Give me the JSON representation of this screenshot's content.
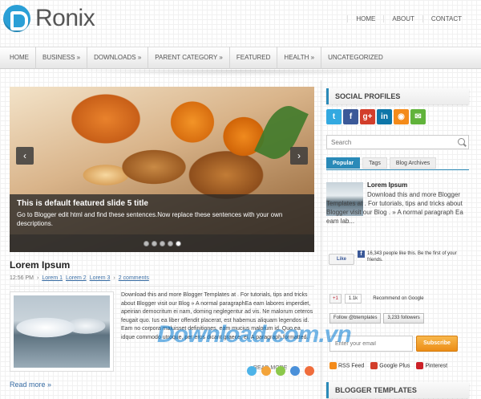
{
  "header": {
    "logo_text": "Ronix",
    "top_nav": [
      "HOME",
      "ABOUT",
      "CONTACT"
    ]
  },
  "menu": {
    "items": [
      "HOME",
      "BUSINESS »",
      "DOWNLOADS »",
      "PARENT CATEGORY »",
      "FEATURED",
      "HEALTH »",
      "UNCATEGORIZED"
    ]
  },
  "slider": {
    "title": "This is default featured slide 5 title",
    "text": "Go to Blogger edit html and find these sentences.Now replace these sentences with your own descriptions.",
    "prev_label": "‹",
    "next_label": "›",
    "active_dot": 5
  },
  "post": {
    "title": "Lorem Ipsum",
    "time": "12:56 PM",
    "labels": [
      "Lorem 1",
      "Lorem 2",
      "Lorem 3"
    ],
    "comments": "2 comments",
    "body": "Download this and more Blogger Templates at . For tutorials, tips and tricks about Blogger visit our Blog » A normal paragraphEa eam labores imperdiet, apeirian democritum ei nam, doming neglegentur ad vis. Ne malorum ceteros feugait quo. Ius ea liber offendit placerat, est habemus aliquam legendos id. Eam no corpora maluisset definitiones, eam mucius malorum id. Quo ea idque commodo utroque, per eros dicant graece, ei. A paragraph formatted.",
    "read_more": "Read more »",
    "more_label": "READ MORE"
  },
  "sidebar": {
    "social_title": "SOCIAL PROFILES",
    "social_icons": [
      {
        "icon": "twitter-icon",
        "glyph": "t",
        "color": "#33a9e0"
      },
      {
        "icon": "facebook-icon",
        "glyph": "f",
        "color": "#3b5998"
      },
      {
        "icon": "googleplus-icon",
        "glyph": "g+",
        "color": "#d23e2b"
      },
      {
        "icon": "linkedin-icon",
        "glyph": "in",
        "color": "#0e76a8"
      },
      {
        "icon": "rss-icon",
        "glyph": "◉",
        "color": "#f48b1a"
      },
      {
        "icon": "email-icon",
        "glyph": "✉",
        "color": "#61b33b"
      }
    ],
    "search_placeholder": "Search",
    "tabs": [
      "Popular",
      "Tags",
      "Blog Archives"
    ],
    "popular_post": {
      "title": "Lorem Ipsum",
      "text": "Download this and more Blogger Templates at . For tutorials, tips and tricks about Blogger visit our Blog . » A normal paragraph Ea eam lab..."
    },
    "fb_like": "Like",
    "fb_text": "16,343 people like this. Be the first of your friends.",
    "gplus_btn": "+1",
    "gplus_count": "1.1k",
    "gplus_text": "Recommend on Google",
    "twitter_follow": "Follow @btemplates",
    "twitter_count": "3,233 followers",
    "email_placeholder": "Enter your email",
    "subscribe_label": "Subscribe",
    "feeds": [
      {
        "label": "RSS Feed",
        "color": "#f48b1a"
      },
      {
        "label": "Google Plus",
        "color": "#d23e2b"
      },
      {
        "label": "Pinterest",
        "color": "#cb2027"
      }
    ],
    "templates_title": "BLOGGER TEMPLATES"
  },
  "watermark": {
    "text": "Download.com.vn",
    "dot_colors": [
      "#4db3e8",
      "#f3a43a",
      "#8cc84b",
      "#4a90d9",
      "#f06d3c"
    ]
  },
  "colors": {
    "accent": "#2a8ab8",
    "link": "#3a6ea5",
    "subscribe": "#ec8d16"
  }
}
